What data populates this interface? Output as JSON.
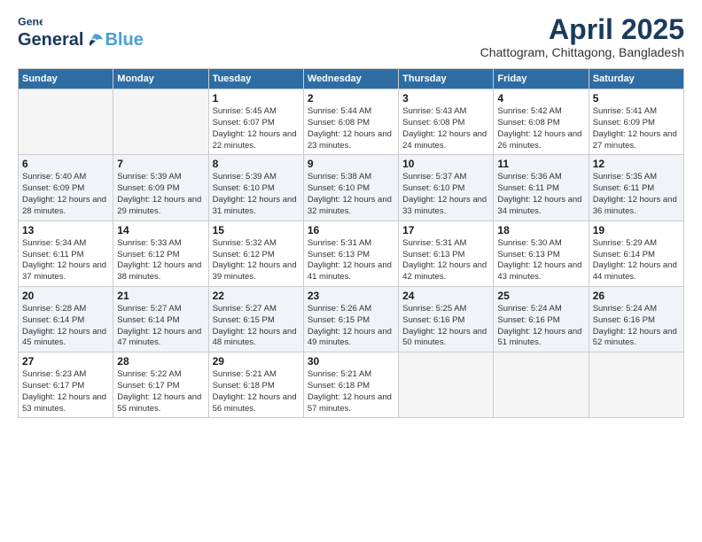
{
  "header": {
    "logo_general": "General",
    "logo_blue": "Blue",
    "title": "April 2025",
    "subtitle": "Chattogram, Chittagong, Bangladesh"
  },
  "weekdays": [
    "Sunday",
    "Monday",
    "Tuesday",
    "Wednesday",
    "Thursday",
    "Friday",
    "Saturday"
  ],
  "weeks": [
    [
      {
        "day": "",
        "info": ""
      },
      {
        "day": "",
        "info": ""
      },
      {
        "day": "1",
        "info": "Sunrise: 5:45 AM\nSunset: 6:07 PM\nDaylight: 12 hours and 22 minutes."
      },
      {
        "day": "2",
        "info": "Sunrise: 5:44 AM\nSunset: 6:08 PM\nDaylight: 12 hours and 23 minutes."
      },
      {
        "day": "3",
        "info": "Sunrise: 5:43 AM\nSunset: 6:08 PM\nDaylight: 12 hours and 24 minutes."
      },
      {
        "day": "4",
        "info": "Sunrise: 5:42 AM\nSunset: 6:08 PM\nDaylight: 12 hours and 26 minutes."
      },
      {
        "day": "5",
        "info": "Sunrise: 5:41 AM\nSunset: 6:09 PM\nDaylight: 12 hours and 27 minutes."
      }
    ],
    [
      {
        "day": "6",
        "info": "Sunrise: 5:40 AM\nSunset: 6:09 PM\nDaylight: 12 hours and 28 minutes."
      },
      {
        "day": "7",
        "info": "Sunrise: 5:39 AM\nSunset: 6:09 PM\nDaylight: 12 hours and 29 minutes."
      },
      {
        "day": "8",
        "info": "Sunrise: 5:39 AM\nSunset: 6:10 PM\nDaylight: 12 hours and 31 minutes."
      },
      {
        "day": "9",
        "info": "Sunrise: 5:38 AM\nSunset: 6:10 PM\nDaylight: 12 hours and 32 minutes."
      },
      {
        "day": "10",
        "info": "Sunrise: 5:37 AM\nSunset: 6:10 PM\nDaylight: 12 hours and 33 minutes."
      },
      {
        "day": "11",
        "info": "Sunrise: 5:36 AM\nSunset: 6:11 PM\nDaylight: 12 hours and 34 minutes."
      },
      {
        "day": "12",
        "info": "Sunrise: 5:35 AM\nSunset: 6:11 PM\nDaylight: 12 hours and 36 minutes."
      }
    ],
    [
      {
        "day": "13",
        "info": "Sunrise: 5:34 AM\nSunset: 6:11 PM\nDaylight: 12 hours and 37 minutes."
      },
      {
        "day": "14",
        "info": "Sunrise: 5:33 AM\nSunset: 6:12 PM\nDaylight: 12 hours and 38 minutes."
      },
      {
        "day": "15",
        "info": "Sunrise: 5:32 AM\nSunset: 6:12 PM\nDaylight: 12 hours and 39 minutes."
      },
      {
        "day": "16",
        "info": "Sunrise: 5:31 AM\nSunset: 6:13 PM\nDaylight: 12 hours and 41 minutes."
      },
      {
        "day": "17",
        "info": "Sunrise: 5:31 AM\nSunset: 6:13 PM\nDaylight: 12 hours and 42 minutes."
      },
      {
        "day": "18",
        "info": "Sunrise: 5:30 AM\nSunset: 6:13 PM\nDaylight: 12 hours and 43 minutes."
      },
      {
        "day": "19",
        "info": "Sunrise: 5:29 AM\nSunset: 6:14 PM\nDaylight: 12 hours and 44 minutes."
      }
    ],
    [
      {
        "day": "20",
        "info": "Sunrise: 5:28 AM\nSunset: 6:14 PM\nDaylight: 12 hours and 45 minutes."
      },
      {
        "day": "21",
        "info": "Sunrise: 5:27 AM\nSunset: 6:14 PM\nDaylight: 12 hours and 47 minutes."
      },
      {
        "day": "22",
        "info": "Sunrise: 5:27 AM\nSunset: 6:15 PM\nDaylight: 12 hours and 48 minutes."
      },
      {
        "day": "23",
        "info": "Sunrise: 5:26 AM\nSunset: 6:15 PM\nDaylight: 12 hours and 49 minutes."
      },
      {
        "day": "24",
        "info": "Sunrise: 5:25 AM\nSunset: 6:16 PM\nDaylight: 12 hours and 50 minutes."
      },
      {
        "day": "25",
        "info": "Sunrise: 5:24 AM\nSunset: 6:16 PM\nDaylight: 12 hours and 51 minutes."
      },
      {
        "day": "26",
        "info": "Sunrise: 5:24 AM\nSunset: 6:16 PM\nDaylight: 12 hours and 52 minutes."
      }
    ],
    [
      {
        "day": "27",
        "info": "Sunrise: 5:23 AM\nSunset: 6:17 PM\nDaylight: 12 hours and 53 minutes."
      },
      {
        "day": "28",
        "info": "Sunrise: 5:22 AM\nSunset: 6:17 PM\nDaylight: 12 hours and 55 minutes."
      },
      {
        "day": "29",
        "info": "Sunrise: 5:21 AM\nSunset: 6:18 PM\nDaylight: 12 hours and 56 minutes."
      },
      {
        "day": "30",
        "info": "Sunrise: 5:21 AM\nSunset: 6:18 PM\nDaylight: 12 hours and 57 minutes."
      },
      {
        "day": "",
        "info": ""
      },
      {
        "day": "",
        "info": ""
      },
      {
        "day": "",
        "info": ""
      }
    ]
  ]
}
